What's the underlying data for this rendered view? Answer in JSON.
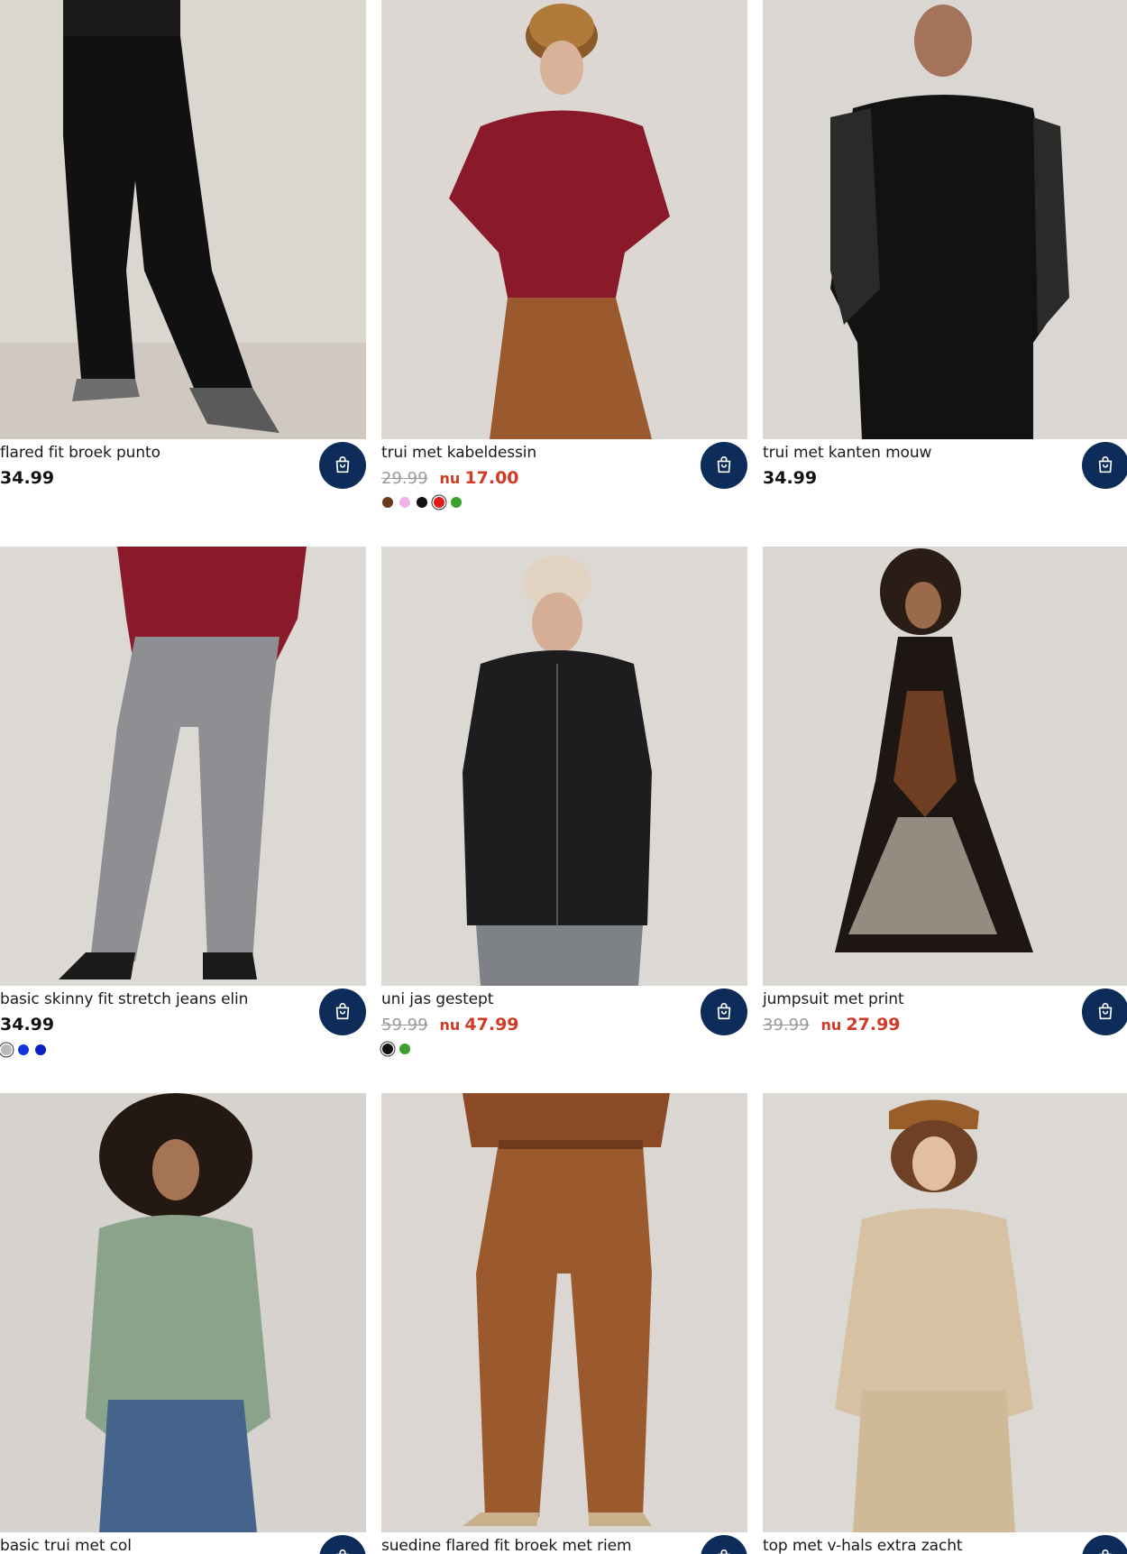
{
  "products": [
    {
      "title": "flared fit broek punto",
      "price": "34.99",
      "swatches": []
    },
    {
      "title": "trui met kabeldessin",
      "old_price": "29.99",
      "sale_prefix": "nu",
      "new_price": "17.00",
      "swatches": [
        "#6b3a1c",
        "#f2b0e6",
        "#111111",
        "#e31a1a",
        "#3aa12b"
      ],
      "selected_swatch": 3
    },
    {
      "title": "trui met kanten mouw",
      "price": "34.99",
      "swatches": []
    },
    {
      "title": "basic skinny fit stretch jeans elin",
      "price": "34.99",
      "swatches": [
        "#b9b9b9",
        "#1136d8",
        "#0a1ec2"
      ],
      "selected_swatch": 0
    },
    {
      "title": "uni jas gestept",
      "old_price": "59.99",
      "sale_prefix": "nu",
      "new_price": "47.99",
      "swatches": [
        "#111111",
        "#3aa12b"
      ],
      "selected_swatch": 0
    },
    {
      "title": "jumpsuit met print",
      "old_price": "39.99",
      "sale_prefix": "nu",
      "new_price": "27.99",
      "swatches": []
    },
    {
      "title": "basic trui met col",
      "swatches": []
    },
    {
      "title": "suedine flared fit broek met riem",
      "swatches": []
    },
    {
      "title": "top met v-hals extra zacht",
      "swatches": []
    }
  ],
  "icons": {
    "cart": "shopping-bag-icon"
  },
  "colors": {
    "cart_button": "#0e2c5a",
    "sale": "#d03a26",
    "old_price": "#9a9a9a"
  }
}
